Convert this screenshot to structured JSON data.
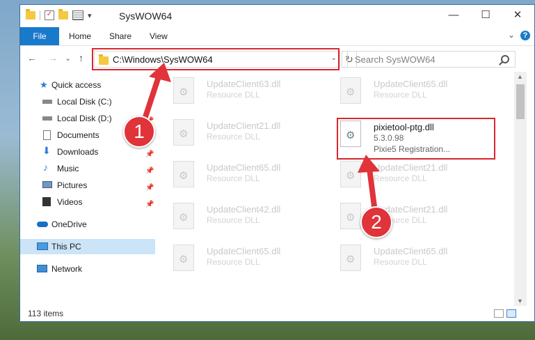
{
  "window": {
    "title": "SysWOW64"
  },
  "titlebar": {
    "qat_dropdown": "▾",
    "minimize": "—",
    "maximize": "☐",
    "close": "✕"
  },
  "ribbon": {
    "tabs": [
      "File",
      "Home",
      "Share",
      "View"
    ],
    "collapse": "⌄",
    "help": "?"
  },
  "nav": {
    "back": "←",
    "forward": "→",
    "recent": "⌄",
    "up": "↑"
  },
  "address": {
    "path": "C:\\Windows\\SysWOW64",
    "dropdown": "⌄",
    "refresh": "↻"
  },
  "search": {
    "placeholder": "Search SysWOW64"
  },
  "sidebar": {
    "items": [
      {
        "label": "Quick access",
        "icon": "star-icon",
        "pinned": false
      },
      {
        "label": "Local Disk (C:)",
        "icon": "drive-icon",
        "pinned": false
      },
      {
        "label": "Local Disk (D:)",
        "icon": "drive-icon",
        "pinned": true
      },
      {
        "label": "Documents",
        "icon": "documents-icon",
        "pinned": true
      },
      {
        "label": "Downloads",
        "icon": "download-icon",
        "pinned": true
      },
      {
        "label": "Music",
        "icon": "music-icon",
        "pinned": true
      },
      {
        "label": "Pictures",
        "icon": "pictures-icon",
        "pinned": true
      },
      {
        "label": "Videos",
        "icon": "videos-icon",
        "pinned": true
      },
      {
        "label": "OneDrive",
        "icon": "cloud-icon",
        "pinned": false
      },
      {
        "label": "This PC",
        "icon": "computer-icon",
        "pinned": false,
        "selected": true
      },
      {
        "label": "Network",
        "icon": "network-icon",
        "pinned": false
      }
    ]
  },
  "files": [
    {
      "name": "UpdateClient63.dll",
      "type": "Resource DLL"
    },
    {
      "name": "UpdateClient65.dll",
      "type": "Resource DLL"
    },
    {
      "name": "UpdateClient21.dll",
      "type": "Resource DLL"
    },
    {
      "name": "pixietool-ptg.dll",
      "version": "5.3.0.98",
      "description": "Pixie5 Registration...",
      "highlighted": true
    },
    {
      "name": "UpdateClient65.dll",
      "type": "Resource DLL"
    },
    {
      "name": "UpdateClient21.dll",
      "type": "Resource DLL"
    },
    {
      "name": "UpdateClient42.dll",
      "type": "Resource DLL"
    },
    {
      "name": "UpdateClient21.dll",
      "type": "Resource DLL"
    },
    {
      "name": "UpdateClient65.dll",
      "type": "Resource DLL"
    },
    {
      "name": "UpdateClient65.dll",
      "type": "Resource DLL"
    }
  ],
  "status": {
    "item_count": "113 items"
  },
  "annotations": {
    "step1": "1",
    "step2": "2",
    "color": "#d9262d"
  }
}
